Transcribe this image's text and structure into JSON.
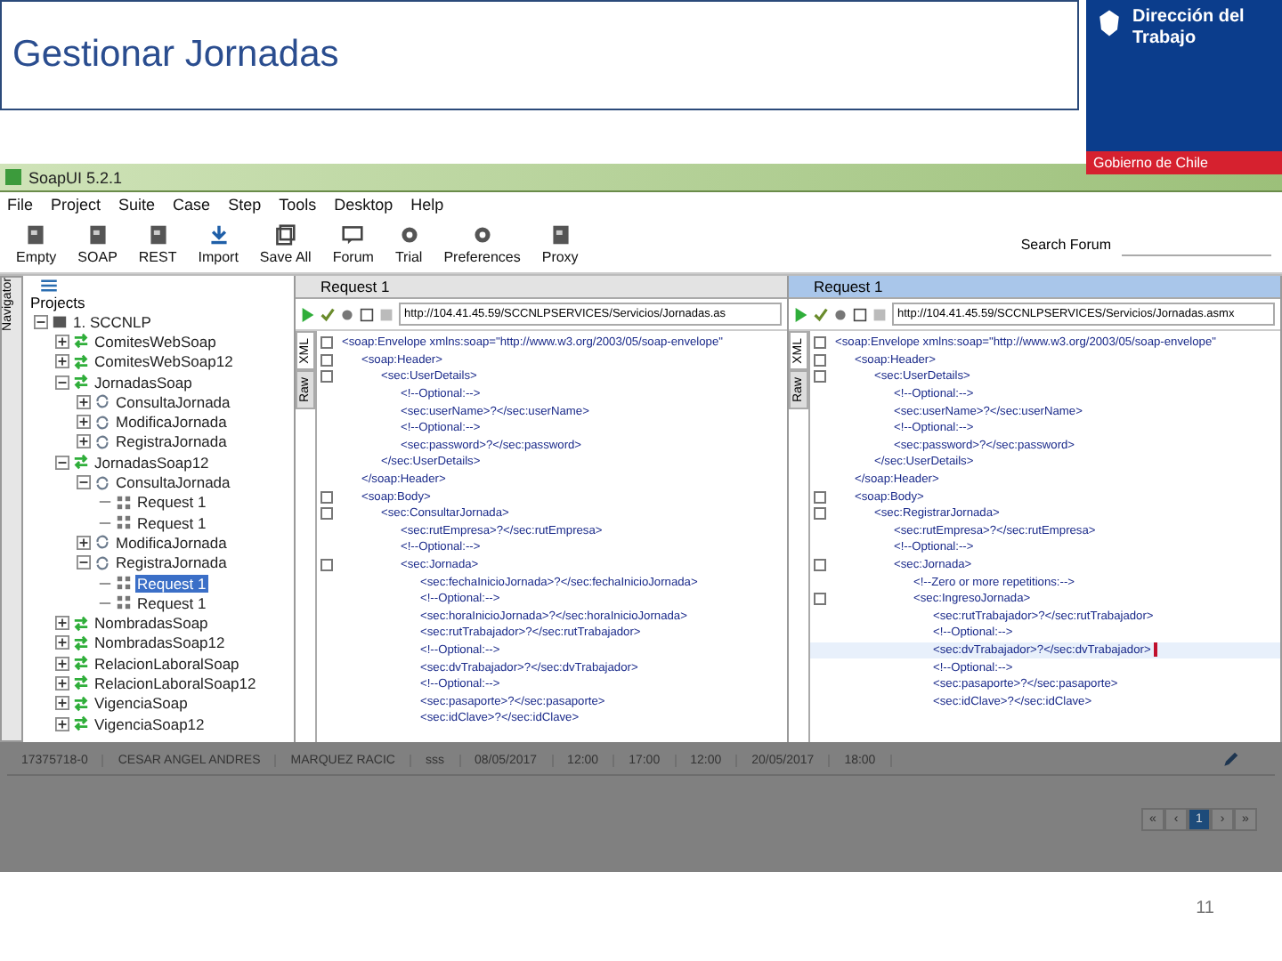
{
  "slide": {
    "title": "Gestionar Jornadas",
    "logo": {
      "name": "Dirección del Trabajo",
      "tagline": "Gobierno de Chile"
    },
    "page_number": "11"
  },
  "app": {
    "window": {
      "title": "SoapUI 5.2.1"
    },
    "menu": [
      "File",
      "Project",
      "Suite",
      "Case",
      "Step",
      "Tools",
      "Desktop",
      "Help"
    ],
    "toolbar": [
      "Empty",
      "SOAP",
      "REST",
      "Import",
      "Save All",
      "Forum",
      "Trial",
      "Preferences",
      "Proxy"
    ],
    "search": {
      "label": "Search Forum"
    },
    "navigator": {
      "tab": "Navigator",
      "heading": "Projects",
      "tree": [
        {
          "label": "1. SCCNLP",
          "kind": "project",
          "expanded": true,
          "selected": false,
          "children": [
            {
              "label": "ComitesWebSoap",
              "kind": "service",
              "expanded": false,
              "selected": false
            },
            {
              "label": "ComitesWebSoap12",
              "kind": "service",
              "expanded": false,
              "selected": false
            },
            {
              "label": "JornadasSoap",
              "kind": "service",
              "expanded": true,
              "selected": false,
              "children": [
                {
                  "label": "ConsultaJornada",
                  "kind": "operation",
                  "expanded": false,
                  "selected": false
                },
                {
                  "label": "ModificaJornada",
                  "kind": "operation",
                  "expanded": false,
                  "selected": false
                },
                {
                  "label": "RegistraJornada",
                  "kind": "operation",
                  "expanded": false,
                  "selected": false
                }
              ]
            },
            {
              "label": "JornadasSoap12",
              "kind": "service",
              "expanded": true,
              "selected": false,
              "children": [
                {
                  "label": "ConsultaJornada",
                  "kind": "operation",
                  "expanded": true,
                  "selected": false,
                  "children": [
                    {
                      "label": "Request 1",
                      "kind": "request",
                      "selected": false
                    },
                    {
                      "label": "Request 1",
                      "kind": "request",
                      "selected": false
                    }
                  ]
                },
                {
                  "label": "ModificaJornada",
                  "kind": "operation",
                  "expanded": false,
                  "selected": false
                },
                {
                  "label": "RegistraJornada",
                  "kind": "operation",
                  "expanded": true,
                  "selected": false,
                  "children": [
                    {
                      "label": "Request 1",
                      "kind": "request",
                      "selected": true
                    },
                    {
                      "label": "Request 1",
                      "kind": "request",
                      "selected": false
                    }
                  ]
                }
              ]
            },
            {
              "label": "NombradasSoap",
              "kind": "service",
              "expanded": false,
              "selected": false
            },
            {
              "label": "NombradasSoap12",
              "kind": "service",
              "expanded": false,
              "selected": false
            },
            {
              "label": "RelacionLaboralSoap",
              "kind": "service",
              "expanded": false,
              "selected": false
            },
            {
              "label": "RelacionLaboralSoap12",
              "kind": "service",
              "expanded": false,
              "selected": false
            },
            {
              "label": "VigenciaSoap",
              "kind": "service",
              "expanded": false,
              "selected": false
            },
            {
              "label": "VigenciaSoap12",
              "kind": "service",
              "expanded": false,
              "selected": false
            }
          ]
        }
      ]
    },
    "requests": [
      {
        "title": "Request 1",
        "focused": false,
        "url": "http://104.41.45.59/SCCNLPSERVICES/Servicios/Jornadas.as",
        "views": [
          {
            "label": "XML",
            "selected": true
          },
          {
            "label": "Raw",
            "selected": false
          }
        ],
        "xml": [
          {
            "text": "<soap:Envelope xmlns:soap=\"http://www.w3.org/2003/05/soap-envelope\"",
            "children": [
              {
                "text": "<soap:Header>",
                "children": [
                  {
                    "text": "<sec:UserDetails>",
                    "children": [
                      {
                        "text": "<!--Optional:-->"
                      },
                      {
                        "text": "<sec:userName>?</sec:userName>"
                      },
                      {
                        "text": "<!--Optional:-->"
                      },
                      {
                        "text": "<sec:password>?</sec:password>"
                      }
                    ]
                  },
                  {
                    "text": "</sec:UserDetails>"
                  }
                ]
              },
              {
                "text": "</soap:Header>"
              },
              {
                "text": "<soap:Body>",
                "children": [
                  {
                    "text": "<sec:ConsultarJornada>",
                    "children": [
                      {
                        "text": "<sec:rutEmpresa>?</sec:rutEmpresa>"
                      },
                      {
                        "text": "<!--Optional:-->"
                      },
                      {
                        "text": "<sec:Jornada>",
                        "children": [
                          {
                            "text": "<sec:fechaInicioJornada>?</sec:fechaInicioJornada>"
                          },
                          {
                            "text": "<!--Optional:-->"
                          },
                          {
                            "text": "<sec:horaInicioJornada>?</sec:horaInicioJornada>"
                          },
                          {
                            "text": "<sec:rutTrabajador>?</sec:rutTrabajador>"
                          },
                          {
                            "text": "<!--Optional:-->"
                          },
                          {
                            "text": "<sec:dvTrabajador>?</sec:dvTrabajador>"
                          },
                          {
                            "text": "<!--Optional:-->"
                          },
                          {
                            "text": "<sec:pasaporte>?</sec:pasaporte>"
                          },
                          {
                            "text": "<sec:idClave>?</sec:idClave>"
                          }
                        ]
                      }
                    ]
                  }
                ]
              }
            ]
          }
        ]
      },
      {
        "title": "Request 1",
        "focused": true,
        "url": "http://104.41.45.59/SCCNLPSERVICES/Servicios/Jornadas.asmx",
        "views": [
          {
            "label": "XML",
            "selected": true
          },
          {
            "label": "Raw",
            "selected": false
          }
        ],
        "xml": [
          {
            "text": "<soap:Envelope xmlns:soap=\"http://www.w3.org/2003/05/soap-envelope\"",
            "children": [
              {
                "text": "<soap:Header>",
                "children": [
                  {
                    "text": "<sec:UserDetails>",
                    "children": [
                      {
                        "text": "<!--Optional:-->"
                      },
                      {
                        "text": "<sec:userName>?</sec:userName>"
                      },
                      {
                        "text": "<!--Optional:-->"
                      },
                      {
                        "text": "<sec:password>?</sec:password>"
                      }
                    ]
                  },
                  {
                    "text": "</sec:UserDetails>"
                  }
                ]
              },
              {
                "text": "</soap:Header>"
              },
              {
                "text": "<soap:Body>",
                "children": [
                  {
                    "text": "<sec:RegistrarJornada>",
                    "children": [
                      {
                        "text": "<sec:rutEmpresa>?</sec:rutEmpresa>"
                      },
                      {
                        "text": "<!--Optional:-->"
                      },
                      {
                        "text": "<sec:Jornada>",
                        "children": [
                          {
                            "text": "<!--Zero or more repetitions:-->"
                          },
                          {
                            "text": "<sec:IngresoJornada>",
                            "children": [
                              {
                                "text": "<sec:rutTrabajador>?</sec:rutTrabajador>"
                              },
                              {
                                "text": "<!--Optional:-->"
                              },
                              {
                                "text": "<sec:dvTrabajador>?</sec:dvTrabajador>",
                                "current": true
                              },
                              {
                                "text": "<!--Optional:-->"
                              },
                              {
                                "text": "<sec:pasaporte>?</sec:pasaporte>"
                              },
                              {
                                "text": "<sec:idClave>?</sec:idClave>"
                              }
                            ]
                          }
                        ]
                      }
                    ]
                  }
                ]
              }
            ]
          }
        ]
      }
    ],
    "table": {
      "row": [
        "17375718-0",
        "CESAR ANGEL ANDRES",
        "MARQUEZ RACIC",
        "sss",
        "08/05/2017",
        "12:00",
        "17:00",
        "12:00",
        "20/05/2017",
        "18:00"
      ]
    },
    "pagination": [
      {
        "label": "«",
        "selected": false
      },
      {
        "label": "‹",
        "selected": false
      },
      {
        "label": "1",
        "selected": true
      },
      {
        "label": "›",
        "selected": false
      },
      {
        "label": "»",
        "selected": false
      }
    ]
  }
}
